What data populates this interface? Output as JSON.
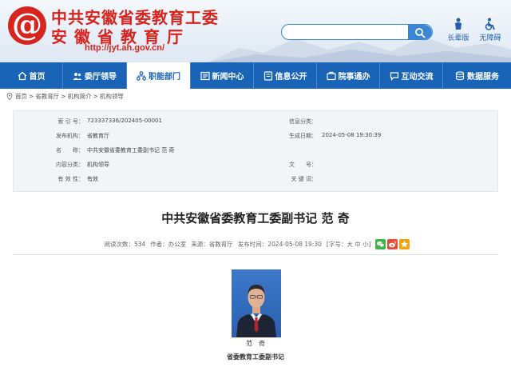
{
  "header": {
    "title_line1": "中共安徽省委教育工委",
    "title_line2": "安徽省教育厅",
    "url": "http://jyt.ah.gov.cn/",
    "search_placeholder": "",
    "tools": [
      {
        "label": "长辈版",
        "icon": "elder-mode-icon"
      },
      {
        "label": "无障碍",
        "icon": "accessibility-icon"
      }
    ],
    "brand_color": "#d8241f",
    "accent_color": "#1a64b8"
  },
  "nav": {
    "items": [
      {
        "label": "首页",
        "icon": "home-icon"
      },
      {
        "label": "委厅领导",
        "icon": "users-icon"
      },
      {
        "label": "职能部门",
        "icon": "org-chart-icon",
        "active": true
      },
      {
        "label": "新闻中心",
        "icon": "news-icon"
      },
      {
        "label": "信息公开",
        "icon": "info-icon"
      },
      {
        "label": "院事通办",
        "icon": "service-icon"
      },
      {
        "label": "互动交流",
        "icon": "chat-icon"
      },
      {
        "label": "数据服务",
        "icon": "data-icon"
      }
    ]
  },
  "breadcrumb": [
    "首页",
    "省教育厅",
    "机构简介",
    "机构领导"
  ],
  "info_table": {
    "rows": [
      {
        "l_label": "索 引 号：",
        "l_value": "723337336/202405-00001",
        "r_label": "信息分类：",
        "r_value": ""
      },
      {
        "l_label": "发布机构：",
        "l_value": "省教育厅",
        "r_label": "生成日期：",
        "r_value": "2024-05-08 19:30:39"
      },
      {
        "l_label": "名　　称：",
        "l_value": "中共安徽省委教育工委副书记 范 奇",
        "r_label": "",
        "r_value": ""
      },
      {
        "l_label": "内容分类：",
        "l_value": "机构领导",
        "r_label": "文　　号：",
        "r_value": ""
      },
      {
        "l_label": "有 效 性：",
        "l_value": "有效",
        "r_label": "关 键 词：",
        "r_value": ""
      }
    ]
  },
  "article": {
    "title": "中共安徽省委教育工委副书记 范 奇",
    "meta": {
      "views": "阅读次数：534",
      "author": "作者：办公室",
      "source": "来源：省教育厅",
      "time": "发布时间：2024-05-08 19:30",
      "font_size": "[字号：大 中 小]"
    },
    "share_icons": [
      {
        "icon": "wechat-icon",
        "color": "#3fb449"
      },
      {
        "icon": "weibo-icon",
        "color": "#e84b3c"
      },
      {
        "icon": "favorite-icon",
        "color": "#f2a20c"
      }
    ],
    "photo_caption": "范　奇",
    "position_caption": "省委教育工委副书记"
  }
}
